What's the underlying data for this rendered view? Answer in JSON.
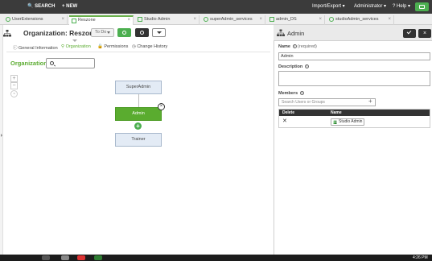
{
  "topnav": {
    "search": "SEARCH",
    "new": "NEW",
    "import_export": "Import/Export",
    "administrator": "Administrator",
    "help": "Help"
  },
  "tabs": [
    {
      "label": "UserExtensions",
      "icon": "circle-icon"
    },
    {
      "label": "Reszone",
      "icon": "org-icon",
      "active": true
    },
    {
      "label": "Studio Admin",
      "icon": "org-icon"
    },
    {
      "label": "superAdmin_services",
      "icon": "circle-icon"
    },
    {
      "label": "admin_DS",
      "icon": "grid-icon"
    },
    {
      "label": "studioAdmin_services",
      "icon": "circle-icon"
    }
  ],
  "header": {
    "title": "Organization: Reszone",
    "status": "To Do"
  },
  "subtabs": {
    "general": "General Information",
    "organization": "Organization",
    "permissions": "Permissions",
    "change_history": "Change History"
  },
  "canvas": {
    "label": "Organization",
    "zoom_in": "+",
    "zoom_out": "−",
    "nodes": {
      "superadmin": "SuperAdmin",
      "admin": "Admin",
      "trainer": "Trainer"
    }
  },
  "panel": {
    "title": "Admin",
    "name_label": "Name",
    "required": "(required)",
    "name_value": "Admin",
    "description_label": "Description",
    "members_label": "Members",
    "members_placeholder": "Search Users or Groups",
    "col_delete": "Delete",
    "col_name": "Name",
    "member_name": "Studio Admin"
  },
  "taskbar": {
    "time": "4:26 PM"
  },
  "colors": {
    "accent": "#5cac32",
    "topnav": "#3b3b3b",
    "node": "#e3ebf5"
  }
}
